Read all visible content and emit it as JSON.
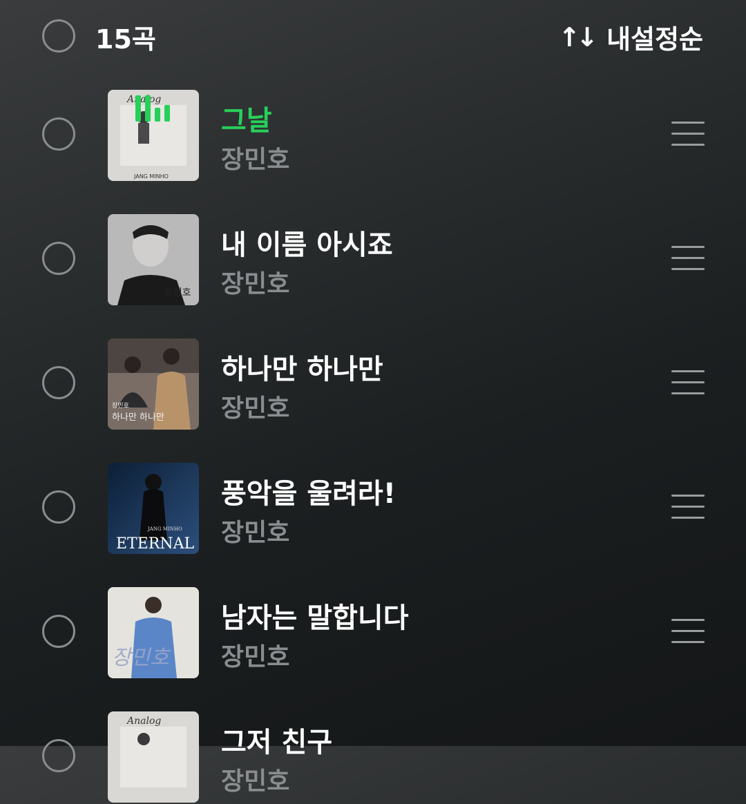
{
  "header": {
    "count_label": "15곡",
    "sort_icon": "sort-arrows-icon",
    "sort_label": "내설정순"
  },
  "tracks": [
    {
      "title": "그날",
      "artist": "장민호",
      "playing": true
    },
    {
      "title": "내 이름 아시죠",
      "artist": "장민호",
      "playing": false
    },
    {
      "title": "하나만 하나만",
      "artist": "장민호",
      "playing": false
    },
    {
      "title": "풍악을 울려라!",
      "artist": "장민호",
      "playing": false
    },
    {
      "title": "남자는 말합니다",
      "artist": "장민호",
      "playing": false
    },
    {
      "title": "그저 친구",
      "artist": "장민호",
      "playing": false
    }
  ],
  "album_texts": {
    "analog": "Analog",
    "jang_minho": "JANG MINHO",
    "eternal": "ETERNAL",
    "hangul_name": "장민호",
    "hana": "하나만 하나만"
  },
  "colors": {
    "accent": "#27d05a",
    "secondary_text": "#8a8d8f"
  }
}
